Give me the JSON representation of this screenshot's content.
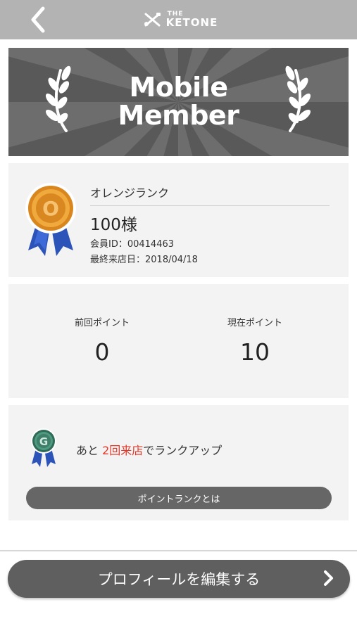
{
  "header": {
    "logo_small": "THE",
    "logo_brand": "KETONE"
  },
  "hero": {
    "title_line1": "Mobile",
    "title_line2": "Member"
  },
  "member": {
    "rank_name": "オレンジランク",
    "medal_letter": "O",
    "name": "100様",
    "member_id": "会員ID：00414463",
    "last_visit": "最終来店日：2018/04/18"
  },
  "points": {
    "previous_label": "前回ポイント",
    "previous_value": "0",
    "current_label": "現在ポイント",
    "current_value": "10"
  },
  "rankup": {
    "medal_letter": "G",
    "text_prefix": "あと",
    "text_highlight": "2回来店",
    "text_suffix": "でランクアップ",
    "about_button": "ポイントランクとは"
  },
  "footer": {
    "profile_button": "プロフィールを編集する"
  },
  "colors": {
    "header_bg": "#b3b3b3",
    "hero_bg": "#6d6d6d",
    "card_bg": "#f3f3f3",
    "highlight": "#e0382b",
    "button_bg": "#5f5f5f",
    "orange_medal": "#e8952a",
    "green_medal": "#3e7f6a",
    "ribbon_blue": "#2b53b8"
  },
  "icons": {
    "back": "chevron-left-icon",
    "logo": "fork-knife-icon",
    "laurel": "laurel-icon",
    "profile_arrow": "chevron-right-icon"
  }
}
